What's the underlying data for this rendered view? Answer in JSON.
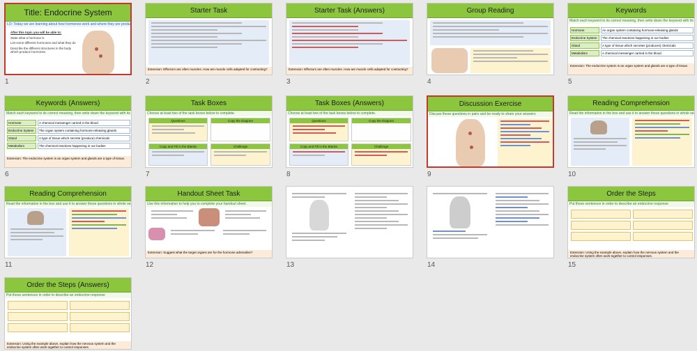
{
  "slides": [
    {
      "num": "1",
      "title": "Title: Endocrine System",
      "subtitle": "LO: Today we are learning about how hormones work and where they are produced.",
      "intro": "After this topic you will be able to:",
      "bullets": [
        "State what a hormone is",
        "List some different hormones and what they do",
        "Describe the different structures in the body which produce hormones"
      ]
    },
    {
      "num": "2",
      "title": "Starter Task",
      "footer": "Extension: Effectors are often muscles. How are muscle cells adapted for contracting?"
    },
    {
      "num": "3",
      "title": "Starter Task (Answers)",
      "footer": "Extension: Effectors are often muscles. How are muscle cells adapted for contracting?"
    },
    {
      "num": "4",
      "title": "Group Reading"
    },
    {
      "num": "5",
      "title": "Keywords",
      "subtitle": "Match each keyword to its correct meaning, then write down the keyword with its definition.",
      "keywords": [
        "Hormone",
        "Endocrine System",
        "Gland",
        "Metabolism"
      ],
      "definitions": [
        "An organ system containing hormone-releasing glands",
        "The chemical reactions happening in our bodies",
        "A type of tissue which secretes (produces) chemicals",
        "A chemical messenger carried in the blood"
      ],
      "footer": "Extension: The endocrine system is an organ system and glands are a type of tissue."
    },
    {
      "num": "6",
      "title": "Keywords (Answers)",
      "subtitle": "Match each keyword to its correct meaning, then write down the keyword with its definition.",
      "keywords": [
        "Hormone",
        "Endocrine System",
        "Gland",
        "Metabolism"
      ],
      "definitions": [
        "A chemical messenger carried in the blood",
        "The organ system containing hormone-releasing glands",
        "A type of tissue which secrete (produce) chemicals",
        "The chemical reactions happening in our bodies"
      ],
      "footer": "Extension: The endocrine system is an organ system and glands are a type of tissue."
    },
    {
      "num": "7",
      "title": "Task Boxes",
      "subtitle": "Choose at least two of the task boxes below to complete.",
      "boxes": [
        "Questions",
        "Copy the Diagram",
        "Copy and Fill in the Blanks",
        "Challenge"
      ]
    },
    {
      "num": "8",
      "title": "Task Boxes (Answers)",
      "subtitle": "Choose at least two of the task boxes below to complete.",
      "boxes": [
        "Questions",
        "Copy the Diagram",
        "Copy and Fill in the Blanks",
        "Challenge"
      ]
    },
    {
      "num": "9",
      "title": "Discussion Exercise",
      "subtitle": "Discuss these questions in pairs and be ready to share your answers"
    },
    {
      "num": "10",
      "title": "Reading Comprehension",
      "subtitle": "Read the information in the box and use it to answer these questions in whole sentences."
    },
    {
      "num": "11",
      "title": "Reading Comprehension",
      "subtitle": "Read the information in the box and use it to answer these questions in whole sentences."
    },
    {
      "num": "12",
      "title": "Handout Sheet Task",
      "subtitle": "Use this information to help you to complete your handout sheet.",
      "footer": "Extension: Suggest what the target organs are for the hormone adrenaline?"
    },
    {
      "num": "13",
      "title": ""
    },
    {
      "num": "14",
      "title": ""
    },
    {
      "num": "15",
      "title": "Order the Steps",
      "subtitle": "Put these sentences in order to describe an endocrine response",
      "footer": "Extension: Using the example above, explain how the nervous system and the endocrine system often work together to control responses."
    },
    {
      "num": "16",
      "title": "Order the Steps (Answers)",
      "subtitle": "Put these sentences in order to describe an endocrine response",
      "footer": "Extension: Using the example above, explain how the nervous system and the endocrine system often work together to control responses."
    }
  ]
}
